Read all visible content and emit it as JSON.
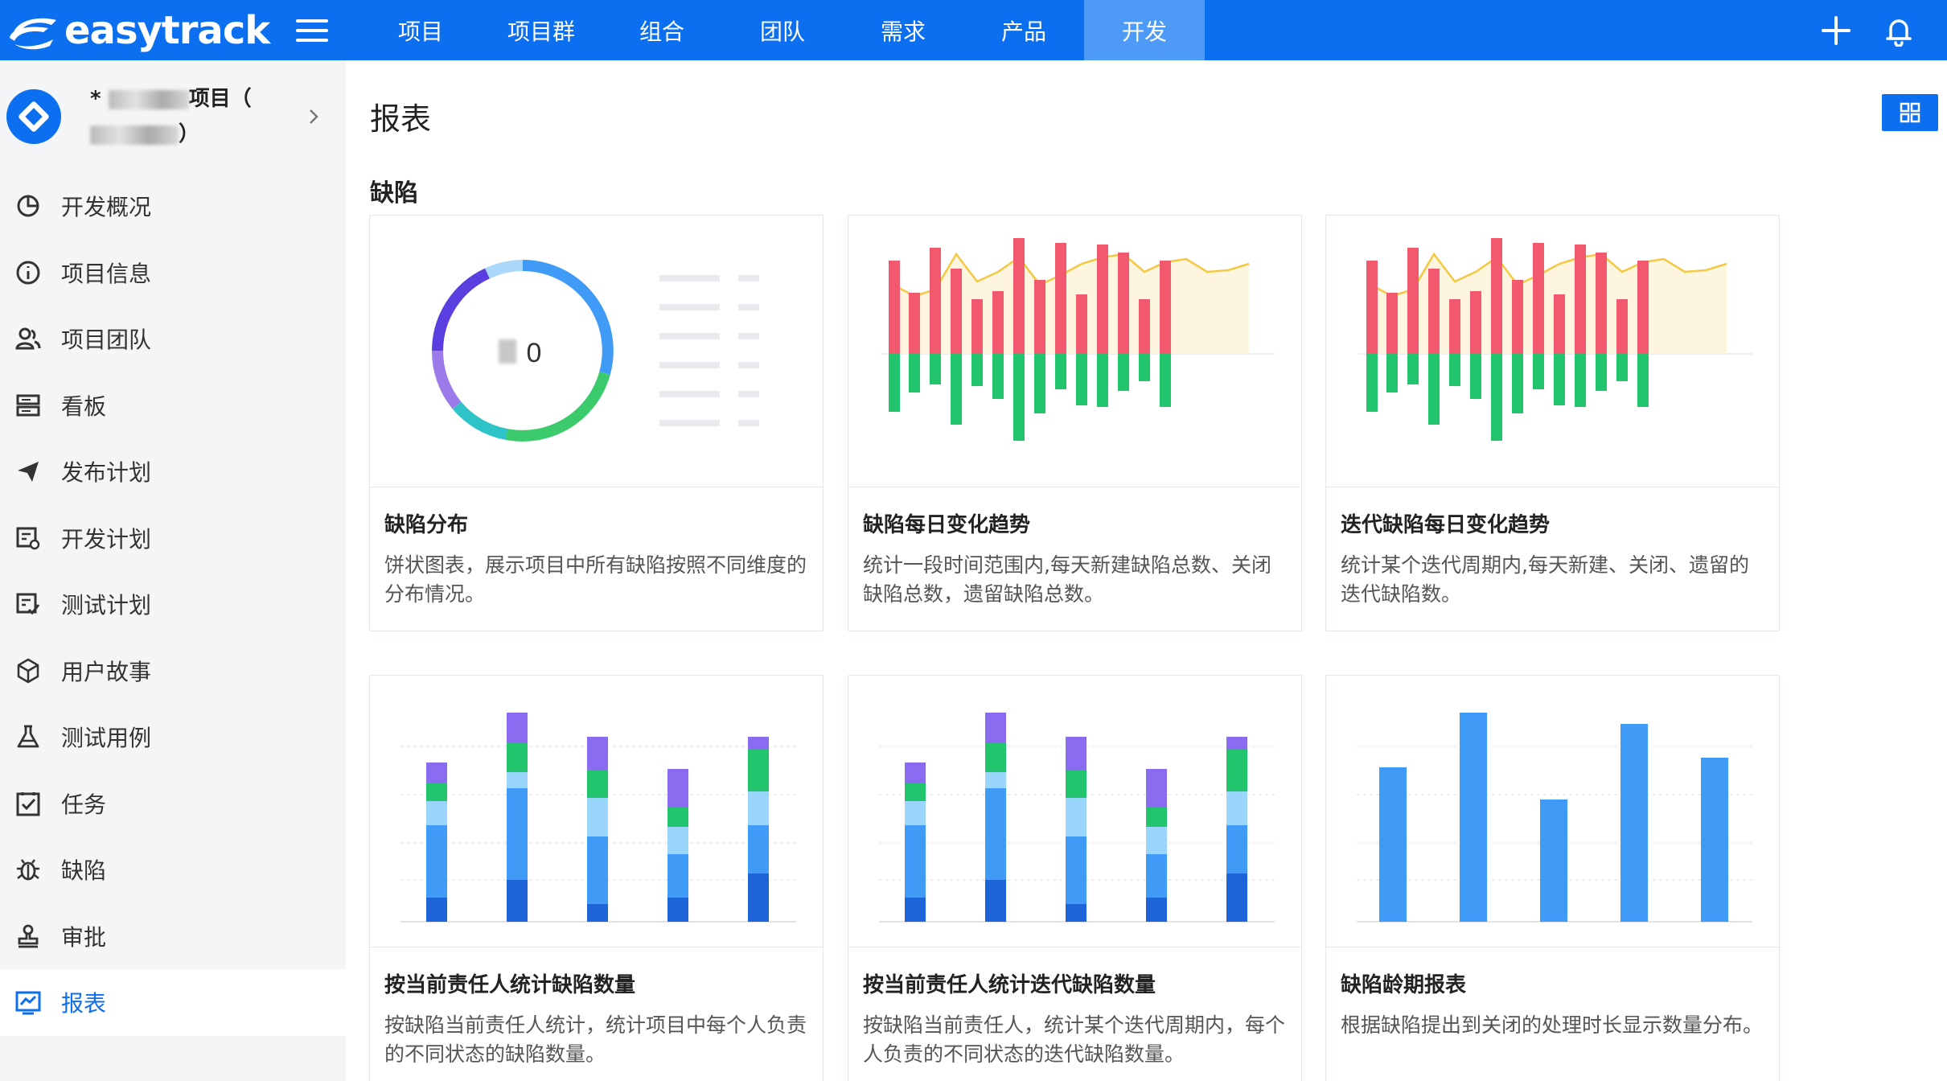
{
  "app": {
    "logo_text": "easytrack"
  },
  "nav": {
    "items": [
      {
        "label": "项目"
      },
      {
        "label": "项目群"
      },
      {
        "label": "组合"
      },
      {
        "label": "团队"
      },
      {
        "label": "需求"
      },
      {
        "label": "产品"
      },
      {
        "label": "开发",
        "active": true
      }
    ]
  },
  "project": {
    "name_line1_suffix": "项目（",
    "name_line2_suffix": "）"
  },
  "sidebar": {
    "items": [
      {
        "label": "开发概况",
        "icon": "pie-chart-icon"
      },
      {
        "label": "项目信息",
        "icon": "info-icon"
      },
      {
        "label": "项目团队",
        "icon": "team-icon"
      },
      {
        "label": "看板",
        "icon": "kanban-icon"
      },
      {
        "label": "发布计划",
        "icon": "send-icon"
      },
      {
        "label": "开发计划",
        "icon": "dev-plan-icon"
      },
      {
        "label": "测试计划",
        "icon": "test-plan-icon"
      },
      {
        "label": "用户故事",
        "icon": "cube-icon"
      },
      {
        "label": "测试用例",
        "icon": "flask-icon"
      },
      {
        "label": "任务",
        "icon": "task-check-icon"
      },
      {
        "label": "缺陷",
        "icon": "bug-icon"
      },
      {
        "label": "审批",
        "icon": "stamp-icon"
      },
      {
        "label": "报表",
        "icon": "report-chart-icon",
        "active": true
      }
    ]
  },
  "page": {
    "title": "报表",
    "section": "缺陷"
  },
  "cards": [
    {
      "title": "缺陷分布",
      "desc": "饼状图表，展示项目中所有缺陷按照不同维度的分布情况。",
      "donut_center": "0"
    },
    {
      "title": "缺陷每日变化趋势",
      "desc": "统计一段时间范围内,每天新建缺陷总数、关闭缺陷总数，遗留缺陷总数。"
    },
    {
      "title": "迭代缺陷每日变化趋势",
      "desc": "统计某个迭代周期内,每天新建、关闭、遗留的迭代缺陷数。"
    },
    {
      "title": "按当前责任人统计缺陷数量",
      "desc": "按缺陷当前责任人统计，统计项目中每个人负责的不同状态的缺陷数量。"
    },
    {
      "title": "按当前责任人统计迭代缺陷数量",
      "desc": "按缺陷当前责任人，统计某个迭代周期内，每个人负责的不同状态的迭代缺陷数量。"
    },
    {
      "title": "缺陷龄期报表",
      "desc": "根据缺陷提出到关闭的处理时长显示数量分布。"
    }
  ],
  "colors": {
    "brand": "#0b6ff0",
    "nav_active": "#4d9bf6",
    "red": "#f2596f",
    "green": "#22c46e",
    "blue": "#3f9bf5",
    "dark_blue": "#1c64d8",
    "light_blue": "#9ad5fb",
    "purple": "#8a6cf0",
    "yellow": "#f5c842"
  }
}
